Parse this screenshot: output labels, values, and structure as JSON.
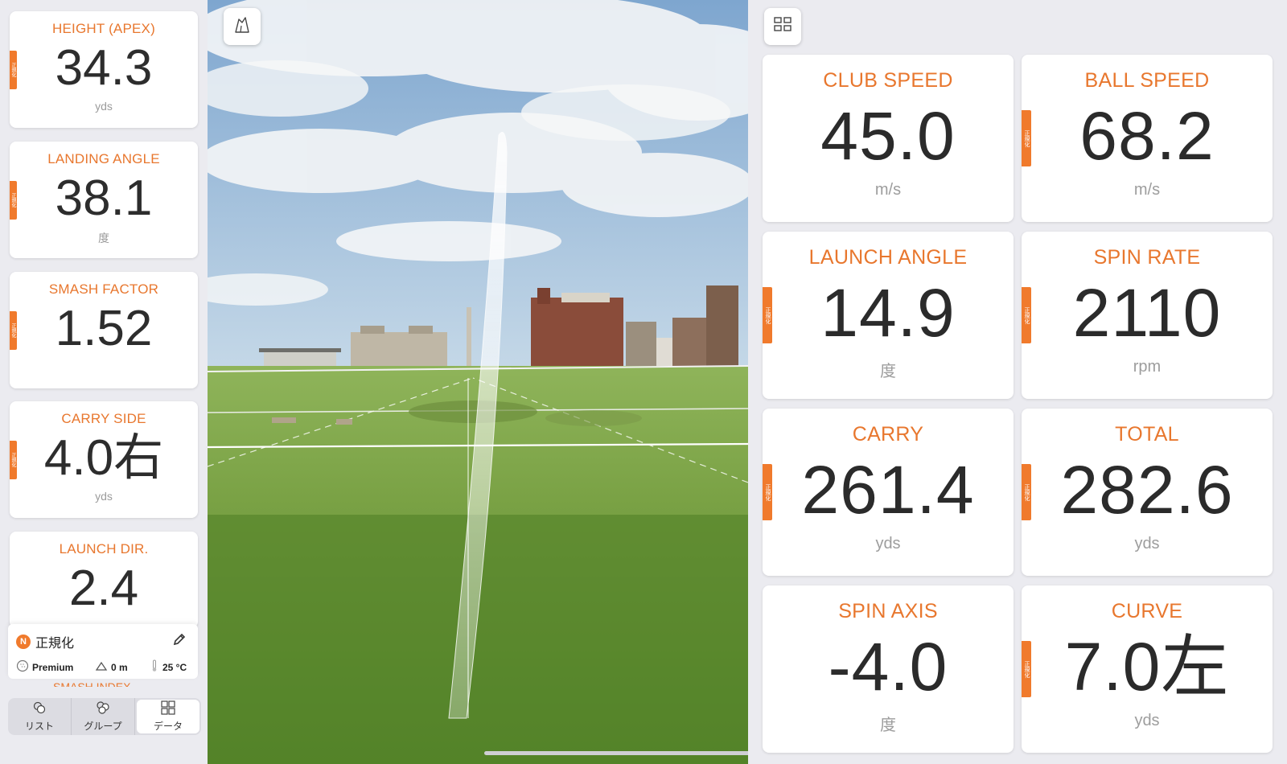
{
  "left_metrics": [
    {
      "label": "HEIGHT (APEX)",
      "value": "34.3",
      "unit": "yds",
      "normalized": true
    },
    {
      "label": "LANDING ANGLE",
      "value": "38.1",
      "unit": "度",
      "normalized": true
    },
    {
      "label": "SMASH FACTOR",
      "value": "1.52",
      "unit": "",
      "normalized": true
    },
    {
      "label": "CARRY SIDE",
      "value": "4.0右",
      "unit": "yds",
      "normalized": true
    },
    {
      "label": "LAUNCH DIR.",
      "value": "2.4",
      "unit": "",
      "normalized": false
    }
  ],
  "norm_tag_text": "正規化",
  "status": {
    "normalize_badge": "N",
    "normalize_label": "正規化",
    "ball_type": "Premium",
    "altitude": "0 m",
    "temperature": "25 °C"
  },
  "peek_label": "SMASH INDEX",
  "tabs": [
    {
      "label": "リスト",
      "icon": "list-balls-icon",
      "active": false
    },
    {
      "label": "グループ",
      "icon": "group-balls-icon",
      "active": false
    },
    {
      "label": "データ",
      "icon": "data-grid-icon",
      "active": true
    }
  ],
  "right_metrics": [
    {
      "label": "CLUB SPEED",
      "value": "45.0",
      "unit": "m/s",
      "normalized": false
    },
    {
      "label": "BALL SPEED",
      "value": "68.2",
      "unit": "m/s",
      "normalized": true
    },
    {
      "label": "LAUNCH ANGLE",
      "value": "14.9",
      "unit": "度",
      "normalized": true
    },
    {
      "label": "SPIN RATE",
      "value": "2110",
      "unit": "rpm",
      "normalized": true
    },
    {
      "label": "CARRY",
      "value": "261.4",
      "unit": "yds",
      "normalized": true
    },
    {
      "label": "TOTAL",
      "value": "282.6",
      "unit": "yds",
      "normalized": true
    },
    {
      "label": "SPIN AXIS",
      "value": "-4.0",
      "unit": "度",
      "normalized": false
    },
    {
      "label": "CURVE",
      "value": "7.0左",
      "unit": "yds",
      "normalized": true
    }
  ],
  "colors": {
    "accent": "#e8772e",
    "tag": "#f07a2c",
    "value_text": "#2d2d2d",
    "sky": "#8fb4d6",
    "grass": "#6e9a3c"
  }
}
